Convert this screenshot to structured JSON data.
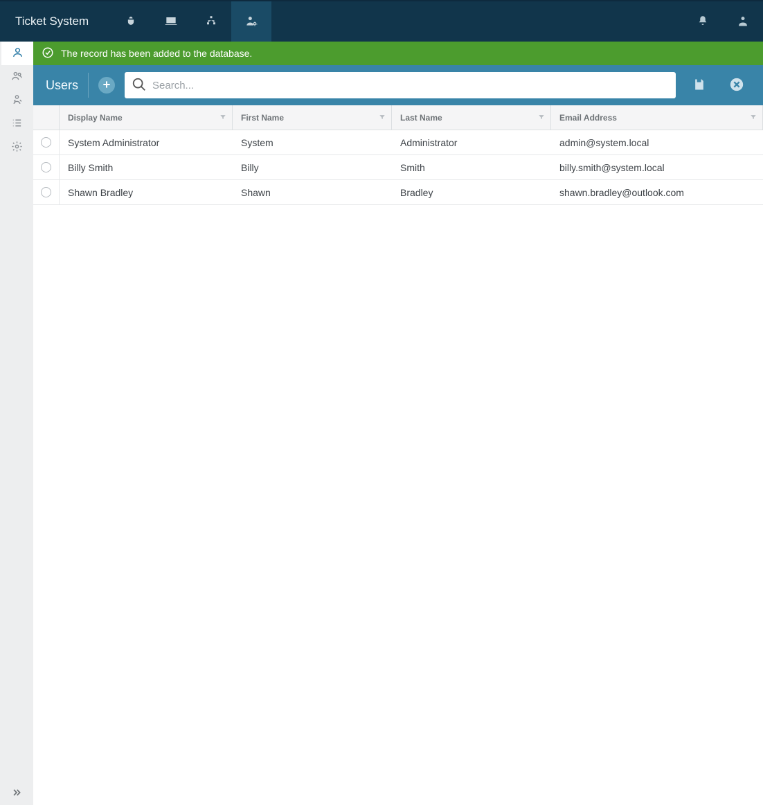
{
  "brand": "Ticket System",
  "topnav": {
    "items": [
      {
        "name": "bugs",
        "active": false
      },
      {
        "name": "laptop",
        "active": false
      },
      {
        "name": "org",
        "active": false
      },
      {
        "name": "user-admin",
        "active": true
      }
    ]
  },
  "banner": {
    "message": "The record has been added to the database."
  },
  "toolbar": {
    "title": "Users",
    "search_placeholder": "Search..."
  },
  "columns": {
    "display": "Display Name",
    "first": "First Name",
    "last": "Last Name",
    "email": "Email Address"
  },
  "rows": [
    {
      "display": "System Administrator",
      "first": "System",
      "last": "Administrator",
      "email": "admin@system.local"
    },
    {
      "display": "Billy Smith",
      "first": "Billy",
      "last": "Smith",
      "email": "billy.smith@system.local"
    },
    {
      "display": "Shawn Bradley",
      "first": "Shawn",
      "last": "Bradley",
      "email": "shawn.bradley@outlook.com"
    }
  ]
}
